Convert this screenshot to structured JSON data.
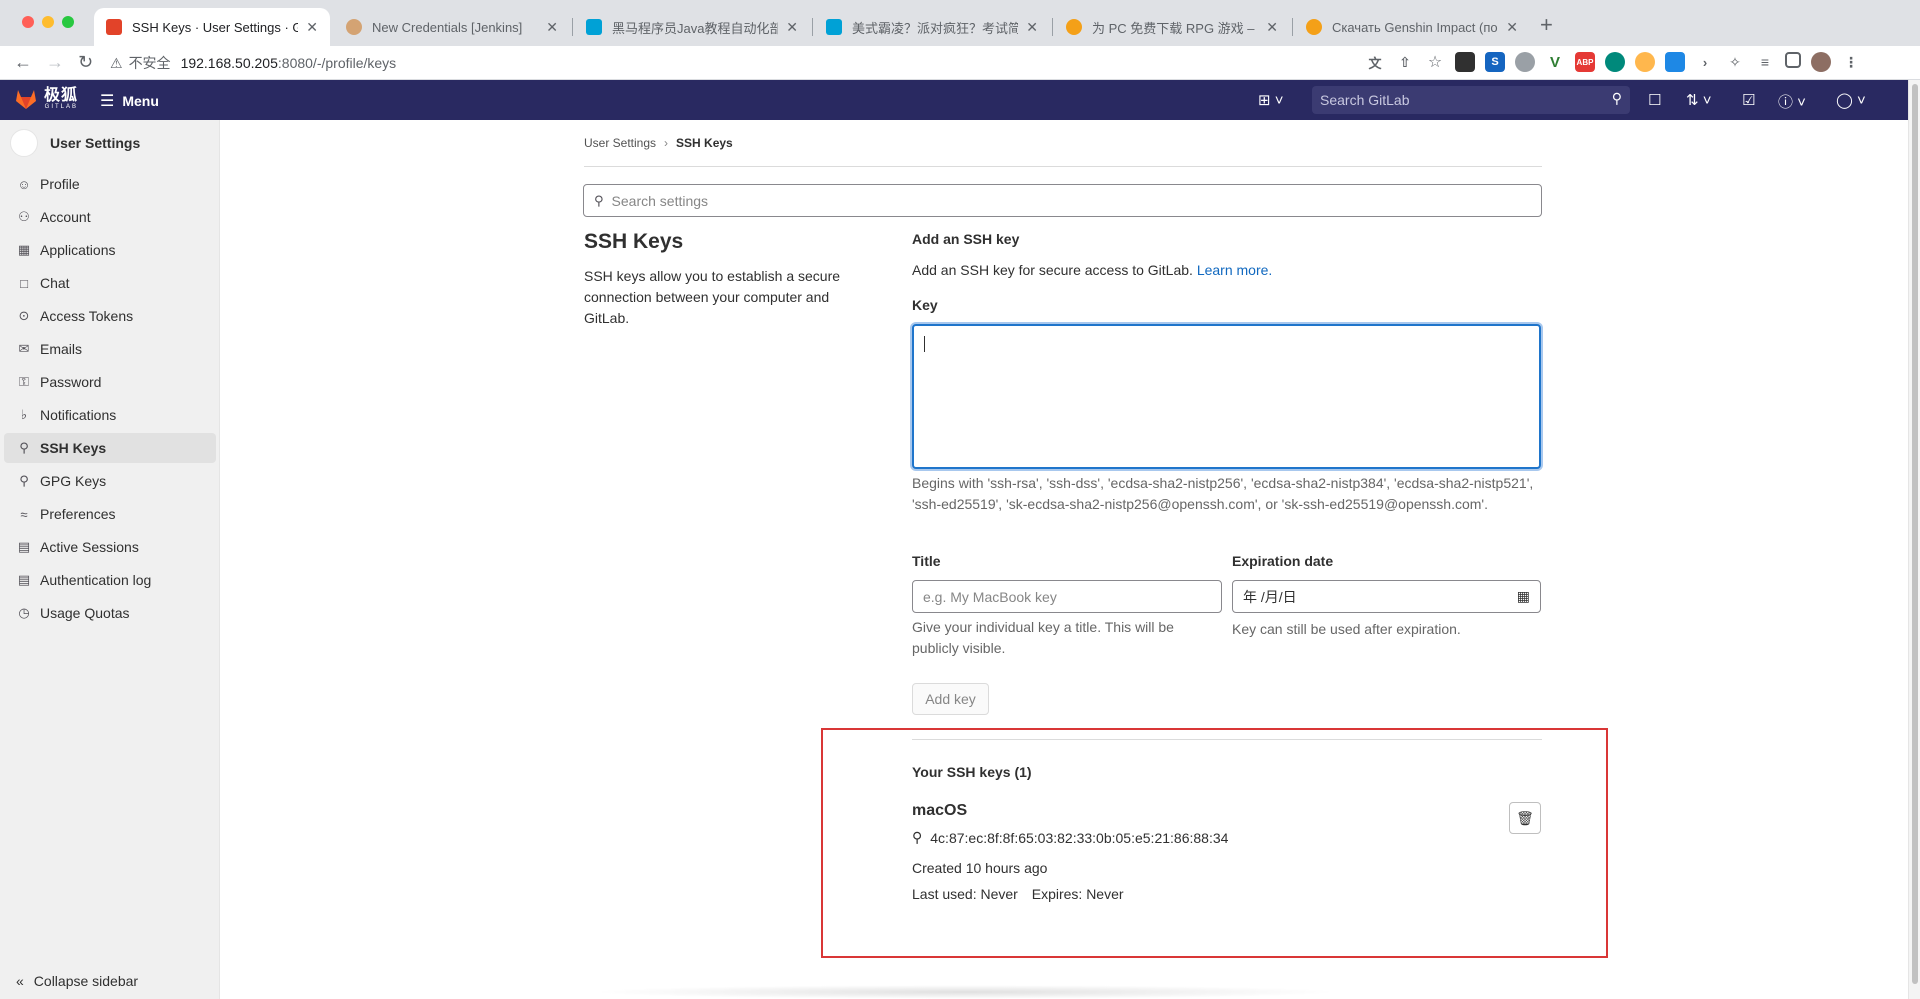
{
  "browser": {
    "tabs": [
      {
        "title": "SSH Keys · User Settings · GitLab",
        "color": "#e24329",
        "active": true
      },
      {
        "title": "New Credentials [Jenkins]",
        "color": "#d4a373",
        "active": false
      },
      {
        "title": "黑马程序员Java教程自动化部署",
        "color": "#00a1d6",
        "active": false
      },
      {
        "title": "美式霸凌？派对疯狂？考试简单？",
        "color": "#00a1d6",
        "active": false
      },
      {
        "title": "为 PC 免费下载 RPG 游戏 – 《原神》",
        "color": "#f4a018",
        "active": false
      },
      {
        "title": "Скачать Genshin Impact (последняя версия)",
        "color": "#f4a018",
        "active": false
      }
    ],
    "tab_close": "✕",
    "new_tab": "+",
    "address": {
      "warning": "不安全",
      "host": "192.168.50.205",
      "path": ":8080/-/profile/keys"
    }
  },
  "header": {
    "brand_cn": "极狐",
    "brand_en": "GITLAB",
    "menu_label": "Menu",
    "search_placeholder": "Search GitLab"
  },
  "sidebar": {
    "title": "User Settings",
    "items": [
      {
        "label": "Profile",
        "icon": "profile-icon"
      },
      {
        "label": "Account",
        "icon": "account-icon"
      },
      {
        "label": "Applications",
        "icon": "applications-icon"
      },
      {
        "label": "Chat",
        "icon": "chat-icon"
      },
      {
        "label": "Access Tokens",
        "icon": "token-icon"
      },
      {
        "label": "Emails",
        "icon": "mail-icon"
      },
      {
        "label": "Password",
        "icon": "lock-icon"
      },
      {
        "label": "Notifications",
        "icon": "bell-icon"
      },
      {
        "label": "SSH Keys",
        "icon": "key-icon",
        "active": true
      },
      {
        "label": "GPG Keys",
        "icon": "key-icon"
      },
      {
        "label": "Preferences",
        "icon": "preferences-icon"
      },
      {
        "label": "Active Sessions",
        "icon": "monitor-icon"
      },
      {
        "label": "Authentication log",
        "icon": "log-icon"
      },
      {
        "label": "Usage Quotas",
        "icon": "quota-icon"
      }
    ],
    "collapse": "Collapse sidebar"
  },
  "breadcrumb": {
    "parent": "User Settings",
    "current": "SSH Keys"
  },
  "settings_search_placeholder": "Search settings",
  "section": {
    "title": "SSH Keys",
    "description": "SSH keys allow you to establish a secure connection between your computer and GitLab."
  },
  "form": {
    "heading": "Add an SSH key",
    "intro": "Add an SSH key for secure access to GitLab.",
    "learn_more": "Learn more.",
    "key_label": "Key",
    "key_value": "",
    "key_help": "Begins with 'ssh-rsa', 'ssh-dss', 'ecdsa-sha2-nistp256', 'ecdsa-sha2-nistp384', 'ecdsa-sha2-nistp521', 'ssh-ed25519', 'sk-ecdsa-sha2-nistp256@openssh.com', or 'sk-ssh-ed25519@openssh.com'.",
    "title_label": "Title",
    "title_placeholder": "e.g. My MacBook key",
    "title_help": "Give your individual key a title. This will be publicly visible.",
    "expiration_label": "Expiration date",
    "expiration_value": "年 /月/日",
    "expiration_help": "Key can still be used after expiration.",
    "add_button": "Add key"
  },
  "keys": {
    "heading": "Your SSH keys (1)",
    "list": [
      {
        "title": "macOS",
        "fingerprint": "4c:87:ec:8f:8f:65:03:82:33:0b:05:e5:21:86:88:34",
        "created": "Created 10 hours ago",
        "last_used": "Last used: Never",
        "expires": "Expires: Never"
      }
    ]
  },
  "colors": {
    "header_bg": "#292961",
    "sidebar_bg": "#f0f0f0",
    "link": "#1068bf",
    "focus": "#1f75cb",
    "highlight_box": "#d93636"
  }
}
